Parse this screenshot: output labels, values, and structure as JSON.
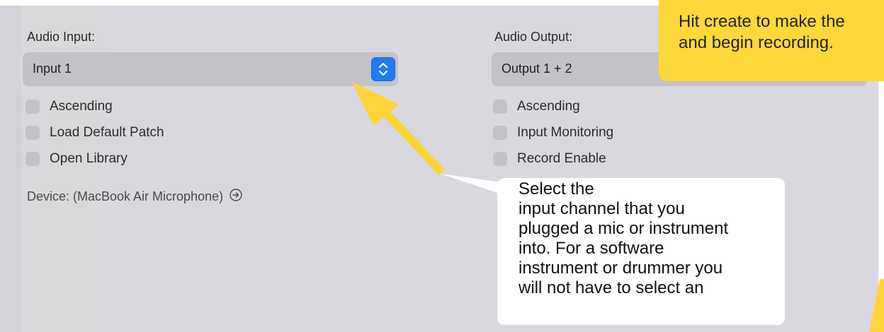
{
  "input": {
    "label": "Audio Input:",
    "value": "Input 1",
    "checkboxes": [
      {
        "label": "Ascending",
        "checked": false
      },
      {
        "label": "Load Default Patch",
        "checked": false
      },
      {
        "label": "Open Library",
        "checked": false
      }
    ],
    "device_text": "Device: (MacBook Air Microphone)"
  },
  "output": {
    "label": "Audio Output:",
    "value": "Output 1 + 2",
    "checkboxes": [
      {
        "label": "Ascending",
        "checked": false
      },
      {
        "label": "Input Monitoring",
        "checked": false
      },
      {
        "label": "Record Enable",
        "checked": false
      }
    ]
  },
  "callouts": {
    "create_text": "Hit create to make the\nand begin recording.",
    "input_text": "Select the\ninput channel that you\nplugged a mic or instrument\ninto. For a software\ninstrument or drummer you\nwill not have to select an"
  },
  "colors": {
    "panel": "#d9d8de",
    "accent": "#1c7cf2",
    "callout_yellow": "#ffd83a",
    "arrow_yellow": "#fdd53a"
  },
  "icons": {
    "stepper": "chevron-up-down-icon",
    "device": "arrow-circle-right-icon"
  }
}
